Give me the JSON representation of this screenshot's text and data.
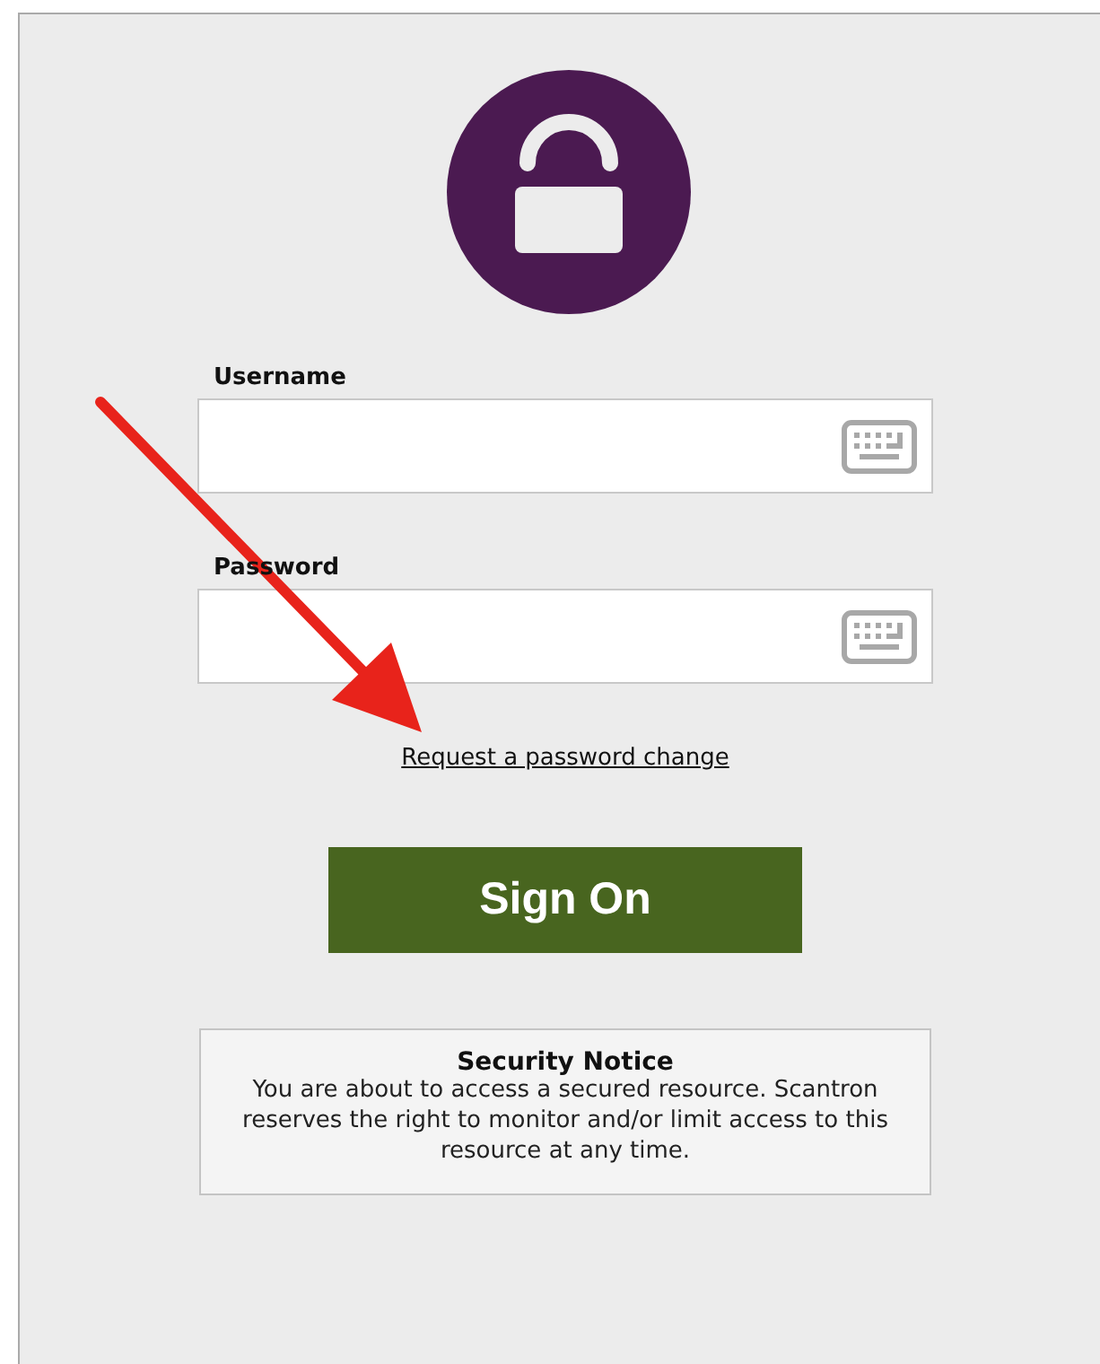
{
  "fields": [
    {
      "label": "Username"
    },
    {
      "label": "Password"
    }
  ],
  "link": "Request a password change",
  "button": "Sign On",
  "notice": {
    "title": "Security Notice",
    "body": "You are about to access a secured resource. Scantron reserves the right to monitor and/or limit access to this resource at any time."
  }
}
